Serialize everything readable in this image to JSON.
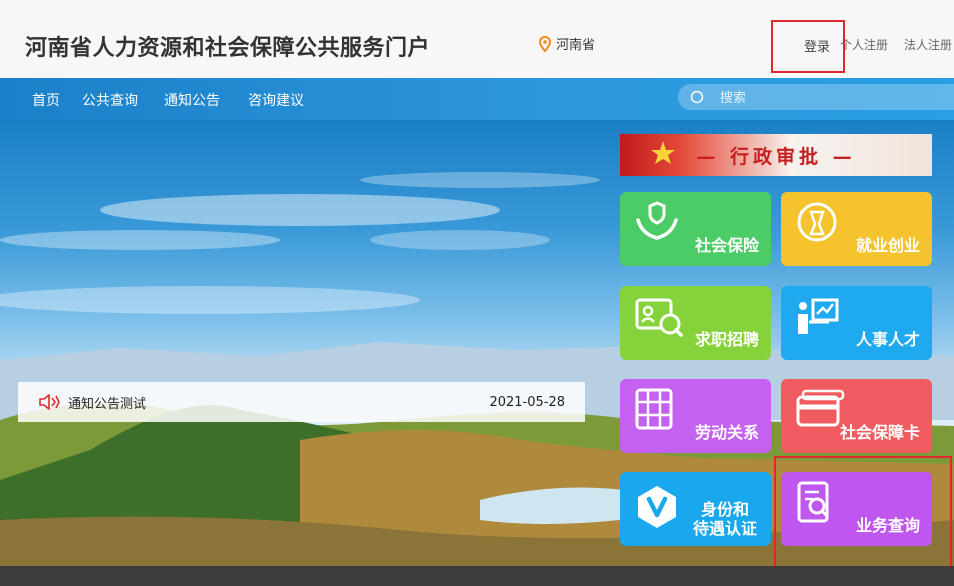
{
  "header": {
    "site_title": "河南省人力资源和社会保障公共服务门户",
    "region": "河南省",
    "login": "登录",
    "personal_register": "个人注册",
    "corporate_register": "法人注册"
  },
  "nav": {
    "items": [
      "首页",
      "公共查询",
      "通知公告",
      "咨询建议"
    ],
    "search_placeholder": "搜索"
  },
  "banner": {
    "admin_approval": "— 行政审批 —"
  },
  "notice": {
    "title": "通知公告测试",
    "date": "2021-05-28"
  },
  "tiles": [
    {
      "label": "社会保险",
      "icon": "insurance-hands-icon"
    },
    {
      "label": "就业创业",
      "icon": "employment-bulb-icon"
    },
    {
      "label": "求职招聘",
      "icon": "recruit-card-icon"
    },
    {
      "label": "人事人才",
      "icon": "talent-presenter-icon"
    },
    {
      "label": "劳动关系",
      "icon": "labor-book-icon"
    },
    {
      "label": "社会保障卡",
      "icon": "security-card-icon"
    },
    {
      "label": "身份和\n待遇认证",
      "icon": "identity-v-icon"
    },
    {
      "label": "业务查询",
      "icon": "business-search-icon"
    }
  ],
  "colors": {
    "nav_blue": "#1b80c9",
    "highlight_red": "#e0282c",
    "tile_green": "#4ccc66",
    "tile_yellow": "#f4c32d",
    "tile_lime": "#86d23b",
    "tile_blue": "#1fa9ee",
    "tile_purple": "#c461f1",
    "tile_red": "#ef5b5e"
  }
}
